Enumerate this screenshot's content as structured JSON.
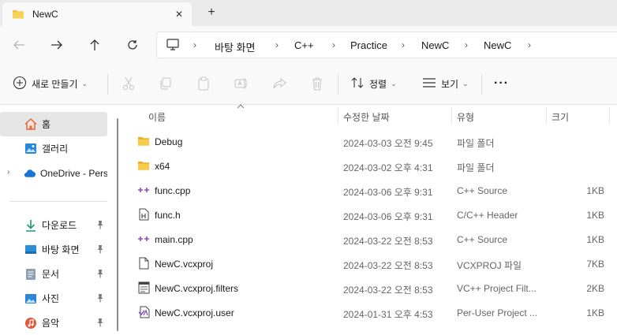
{
  "window": {
    "tab_title": "NewC",
    "close_glyph": "✕",
    "new_tab_glyph": "+"
  },
  "address": {
    "breadcrumbs": [
      "바탕 화면",
      "C++",
      "Practice",
      "NewC",
      "NewC"
    ],
    "separator": "›"
  },
  "toolbar": {
    "new_label": "새로 만들기",
    "sort_label": "정렬",
    "view_label": "보기",
    "more_label": "···",
    "caret": "⌄"
  },
  "sidebar": {
    "items": [
      {
        "label": "홈",
        "icon": "home-icon",
        "selected": true
      },
      {
        "label": "갤러리",
        "icon": "gallery-icon"
      },
      {
        "label": "OneDrive - Pers",
        "icon": "cloud-icon",
        "expandable": true
      }
    ],
    "quick_access": [
      {
        "label": "다운로드",
        "icon": "download-icon",
        "pinned": true
      },
      {
        "label": "바탕 화면",
        "icon": "desktop-icon",
        "pinned": true
      },
      {
        "label": "문서",
        "icon": "document-icon",
        "pinned": true
      },
      {
        "label": "사진",
        "icon": "pictures-icon",
        "pinned": true
      },
      {
        "label": "음악",
        "icon": "music-icon",
        "pinned": true
      }
    ],
    "expander_glyph": "›",
    "pin_glyph": "📌"
  },
  "columns": {
    "name": "이름",
    "modified": "수정한 날짜",
    "type": "유형",
    "size": "크기"
  },
  "files": [
    {
      "name": "Debug",
      "modified": "2024-03-03 오전 9:45",
      "type": "파일 폴더",
      "size": "",
      "icon": "folder-icon"
    },
    {
      "name": "x64",
      "modified": "2024-03-02 오후 4:31",
      "type": "파일 폴더",
      "size": "",
      "icon": "folder-icon"
    },
    {
      "name": "func.cpp",
      "modified": "2024-03-06 오후 9:31",
      "type": "C++ Source",
      "size": "1KB",
      "icon": "cpp-file-icon"
    },
    {
      "name": "func.h",
      "modified": "2024-03-06 오후 9:31",
      "type": "C/C++ Header",
      "size": "1KB",
      "icon": "header-file-icon"
    },
    {
      "name": "main.cpp",
      "modified": "2024-03-22 오전 8:53",
      "type": "C++ Source",
      "size": "1KB",
      "icon": "cpp-file-icon"
    },
    {
      "name": "NewC.vcxproj",
      "modified": "2024-03-22 오전 8:53",
      "type": "VCXPROJ 파일",
      "size": "7KB",
      "icon": "blank-file-icon"
    },
    {
      "name": "NewC.vcxproj.filters",
      "modified": "2024-03-22 오전 8:53",
      "type": "VC++ Project Filt...",
      "size": "2KB",
      "icon": "filters-file-icon"
    },
    {
      "name": "NewC.vcxproj.user",
      "modified": "2024-01-31 오후 4:53",
      "type": "Per-User Project ...",
      "size": "1KB",
      "icon": "vs-user-file-icon"
    }
  ],
  "colors": {
    "folder": "#f3c13a",
    "cpp_accent": "#8a4fbf",
    "onedrive": "#1a73d9",
    "download": "#1a9c6a",
    "desktop": "#2d8fd8",
    "pictures": "#2b86d6",
    "music": "#e05a3a"
  }
}
